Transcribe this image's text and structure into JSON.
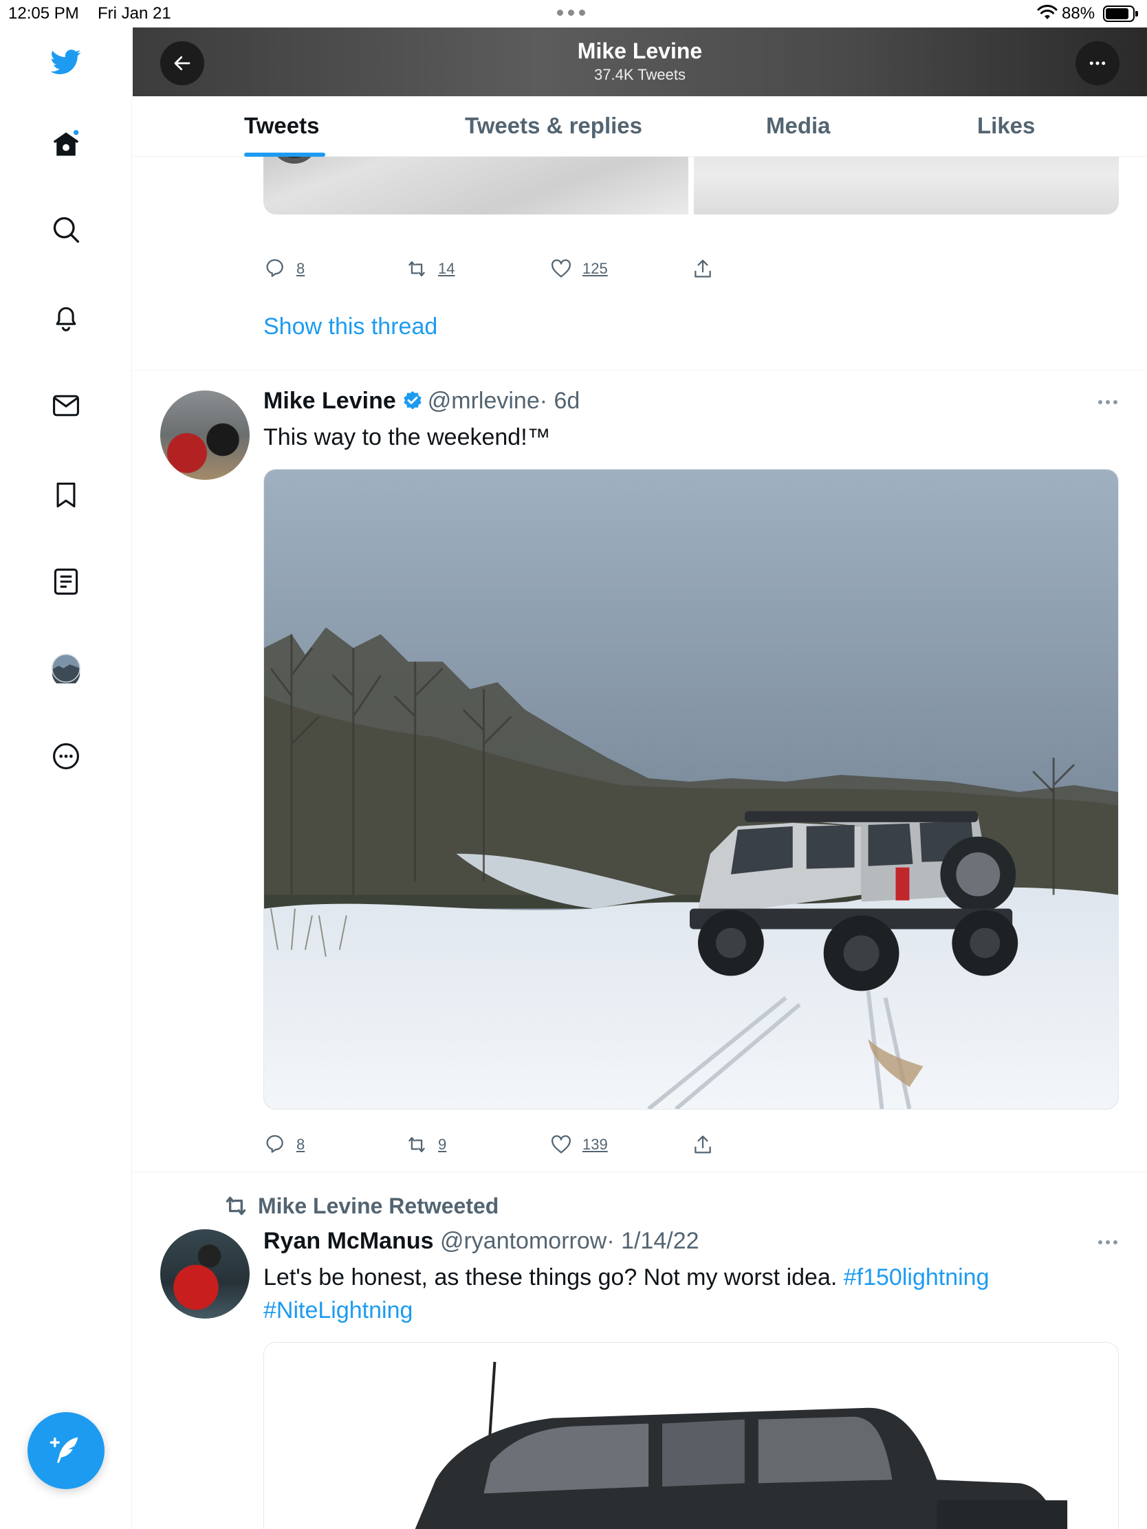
{
  "status_bar": {
    "time": "12:05 PM",
    "date": "Fri Jan 21",
    "battery_pct": "88%"
  },
  "header": {
    "title": "Mike Levine",
    "subtitle": "37.4K Tweets"
  },
  "tabs": [
    {
      "label": "Tweets",
      "active": true
    },
    {
      "label": "Tweets & replies",
      "active": false
    },
    {
      "label": "Media",
      "active": false
    },
    {
      "label": "Likes",
      "active": false
    }
  ],
  "sidebar": {
    "items": [
      "twitter-logo",
      "home",
      "explore",
      "notifications",
      "messages",
      "bookmarks",
      "lists",
      "profile",
      "more"
    ]
  },
  "tweet_prev": {
    "replies": "8",
    "retweets": "14",
    "likes": "125",
    "show_thread": "Show this thread"
  },
  "tweet1": {
    "name": "Mike Levine",
    "handle": "@mrlevine",
    "time": "· 6d",
    "text": "This way to the weekend!™",
    "replies": "8",
    "retweets": "9",
    "likes": "139"
  },
  "tweet2": {
    "retweeted_by": "Mike Levine Retweeted",
    "name": "Ryan McManus",
    "handle": "@ryantomorrow",
    "time": "· 1/14/22",
    "text": "Let's be honest, as these things go? Not my worst idea.",
    "hashtag1": "#f150lightning",
    "hashtag2": "#NiteLightning"
  },
  "colors": {
    "accent": "#1d9bf0",
    "text_primary": "#0f1419",
    "text_secondary": "#536471"
  }
}
